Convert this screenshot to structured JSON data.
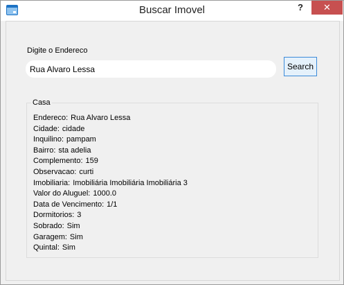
{
  "window": {
    "title": "Buscar Imovel",
    "help_label": "?",
    "close_label": "✕",
    "accent_color": "#c75050"
  },
  "search": {
    "prompt_label": "Digite o Endereco",
    "value": "Rua Alvaro Lessa",
    "button_label": "Search"
  },
  "result": {
    "group_title": "Casa",
    "fields": [
      {
        "label": "Endereco:",
        "value": "Rua Alvaro Lessa"
      },
      {
        "label": "Cidade:",
        "value": "cidade"
      },
      {
        "label": "Inquilino:",
        "value": "pampam"
      },
      {
        "label": "Bairro:",
        "value": "sta adelia"
      },
      {
        "label": "Complemento:",
        "value": "159"
      },
      {
        "label": "Observacao:",
        "value": "curti"
      },
      {
        "label": "Imobiliaria:",
        "value": "Imobiliária Imobiliária Imobiliária 3"
      },
      {
        "label": "Valor do Aluguel:",
        "value": "1000.0"
      },
      {
        "label": "Data de Vencimento:",
        "value": "1/1"
      },
      {
        "label": "Dormitorios:",
        "value": "3"
      },
      {
        "label": "Sobrado:",
        "value": "Sim"
      },
      {
        "label": "Garagem:",
        "value": "Sim"
      },
      {
        "label": "Quintal:",
        "value": "Sim"
      }
    ]
  }
}
